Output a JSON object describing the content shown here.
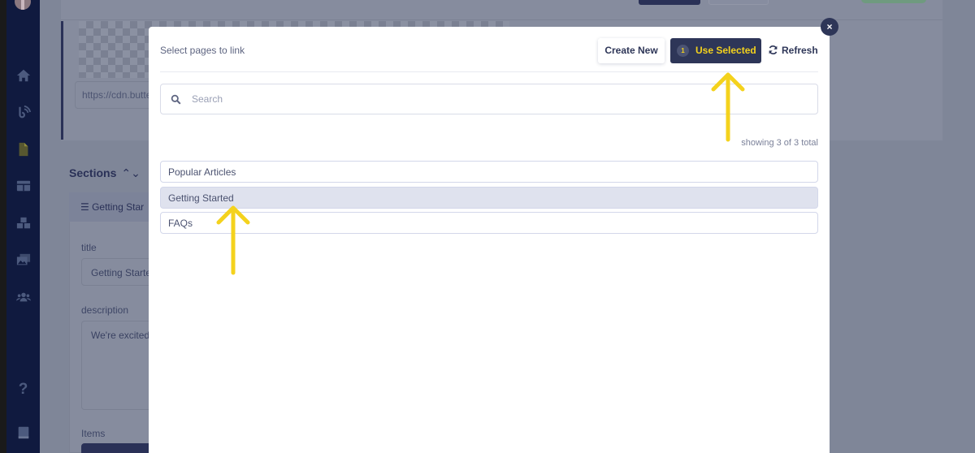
{
  "background": {
    "image_url_field": "https://cdn.butte",
    "sections_heading": "Sections",
    "section_panel_title": "Getting Star",
    "title_label": "title",
    "title_value": "Getting Starte",
    "description_label": "description",
    "description_value": "We're excited",
    "items_label": "Items"
  },
  "sidebar": {
    "items": [
      {
        "icon": "home-icon"
      },
      {
        "icon": "blog-icon"
      },
      {
        "icon": "page-icon",
        "active": true
      },
      {
        "icon": "grid-icon"
      },
      {
        "icon": "components-icon"
      },
      {
        "icon": "media-icon"
      },
      {
        "icon": "users-icon"
      },
      {
        "icon": "help-icon",
        "glyph": "?"
      },
      {
        "icon": "book-icon"
      }
    ]
  },
  "modal": {
    "title": "Select pages to link",
    "create_new_label": "Create New",
    "use_selected_label": "Use Selected",
    "selected_count": "1",
    "refresh_label": "Refresh",
    "close_glyph": "×",
    "search_placeholder": "Search",
    "search_value": "",
    "showing_text": "showing 3 of 3 total",
    "pages": [
      {
        "label": "Popular Articles",
        "selected": false
      },
      {
        "label": "Getting Started",
        "selected": true
      },
      {
        "label": "FAQs",
        "selected": false
      }
    ]
  },
  "colors": {
    "primary": "#2e3658",
    "accent_yellow": "#f4d21d",
    "selected_row": "#dfe2ee",
    "overlay": "#7f8698"
  }
}
